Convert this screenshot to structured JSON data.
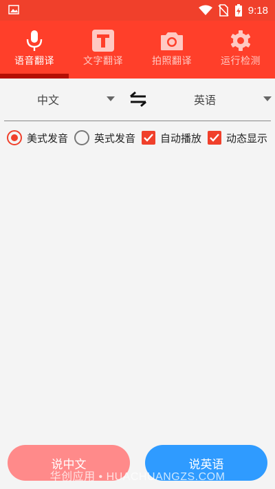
{
  "status_bar": {
    "time": "9:18",
    "icons": [
      "image-icon",
      "wifi-icon",
      "no-sim-icon",
      "battery-charging-icon"
    ]
  },
  "tabs": [
    {
      "label": "语音翻译",
      "icon": "microphone-icon",
      "selected": true
    },
    {
      "label": "文字翻译",
      "icon": "text-t-icon",
      "selected": false
    },
    {
      "label": "拍照翻译",
      "icon": "camera-icon",
      "selected": false
    },
    {
      "label": "运行检测",
      "icon": "gear-icon",
      "selected": false
    }
  ],
  "language": {
    "source": "中文",
    "target": "英语",
    "swap_icon": "swap-arrows-icon"
  },
  "options": {
    "us_pronunciation": {
      "label": "美式发音",
      "selected": true
    },
    "uk_pronunciation": {
      "label": "英式发音",
      "selected": false
    },
    "auto_play": {
      "label": "自动播放",
      "checked": true
    },
    "dynamic_display": {
      "label": "动态显示",
      "checked": true
    }
  },
  "buttons": {
    "speak_chinese": "说中文",
    "speak_english": "说英语"
  },
  "watermark": "华创应用 • HUACHUANGZS.COM",
  "colors": {
    "accent": "#ff3f2a",
    "indicator": "#b40f04",
    "speak_chinese_bg": "#ff8a8a",
    "speak_english_bg": "#2f9bff"
  }
}
